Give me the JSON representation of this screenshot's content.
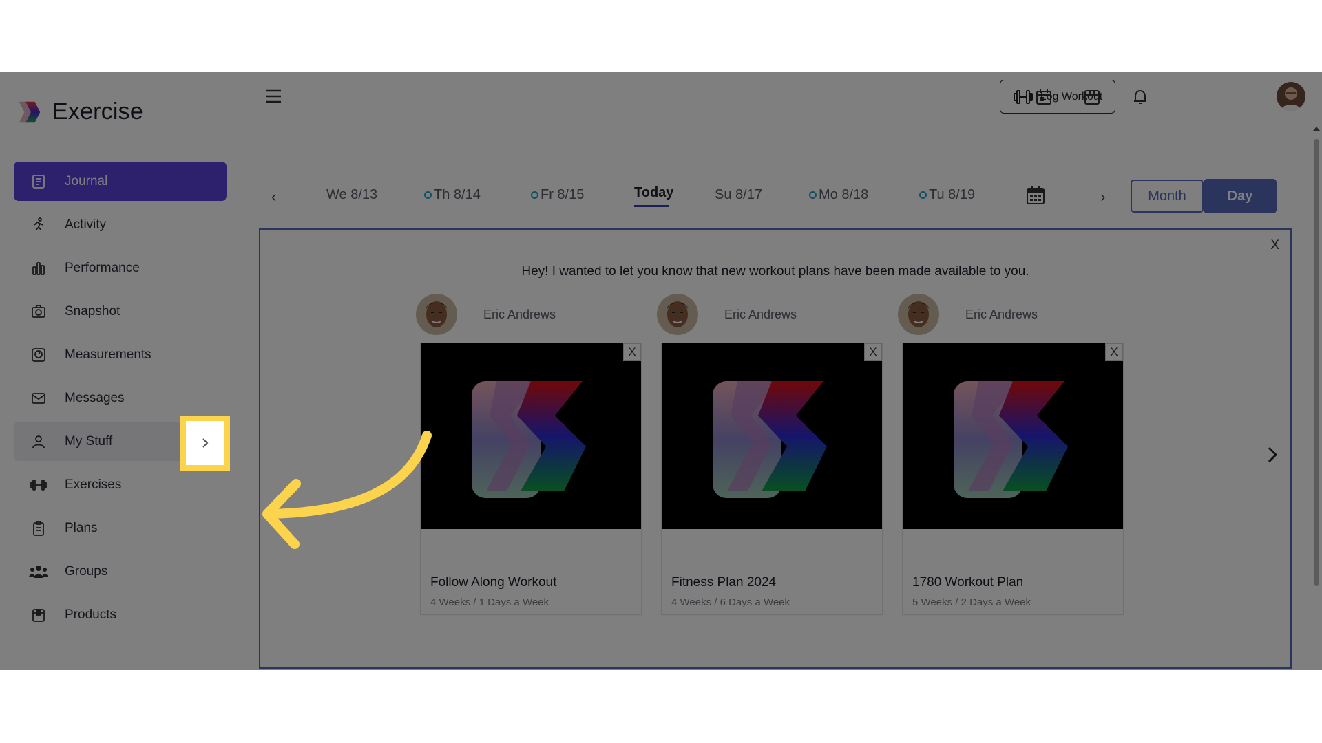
{
  "app": {
    "name": "Exercise"
  },
  "sidebar": {
    "items": [
      {
        "label": "Journal",
        "icon": "journal-icon",
        "active": true
      },
      {
        "label": "Activity",
        "icon": "running-icon"
      },
      {
        "label": "Performance",
        "icon": "bar-chart-icon"
      },
      {
        "label": "Snapshot",
        "icon": "camera-icon"
      },
      {
        "label": "Measurements",
        "icon": "scale-icon"
      },
      {
        "label": "Messages",
        "icon": "mail-icon"
      },
      {
        "label": "My Stuff",
        "icon": "user-icon"
      },
      {
        "label": "Exercises",
        "icon": "dumbbell-icon"
      },
      {
        "label": "Plans",
        "icon": "clipboard-icon"
      },
      {
        "label": "Groups",
        "icon": "group-icon"
      },
      {
        "label": "Products",
        "icon": "box-icon"
      }
    ]
  },
  "header": {
    "log_workout": "Log Workout"
  },
  "dates": {
    "items": [
      {
        "label": "We 8/13",
        "dot": false
      },
      {
        "label": "Th 8/14",
        "dot": true
      },
      {
        "label": "Fr 8/15",
        "dot": true
      },
      {
        "label": "Su 8/17",
        "dot": false
      },
      {
        "label": "Mo 8/18",
        "dot": true
      },
      {
        "label": "Tu 8/19",
        "dot": true
      }
    ],
    "today": "Today",
    "prev": "‹",
    "next": "›"
  },
  "view_toggle": {
    "month": "Month",
    "day": "Day"
  },
  "notification": {
    "close": "X",
    "message": "Hey! I wanted to let you know that new workout plans have been made available to you.",
    "plans": [
      {
        "author": "Eric Andrews",
        "title": "Follow Along Workout",
        "subtitle": "4 Weeks / 1 Days a Week",
        "close": "X"
      },
      {
        "author": "Eric Andrews",
        "title": "Fitness Plan 2024",
        "subtitle": "4 Weeks / 6 Days a Week",
        "close": "X"
      },
      {
        "author": "Eric Andrews",
        "title": "1780 Workout Plan",
        "subtitle": "5 Weeks / 2 Days a Week",
        "close": "X"
      }
    ]
  },
  "colors": {
    "accent": "#5b40d9",
    "primary": "#5668b8",
    "highlight": "#fcd34d"
  }
}
